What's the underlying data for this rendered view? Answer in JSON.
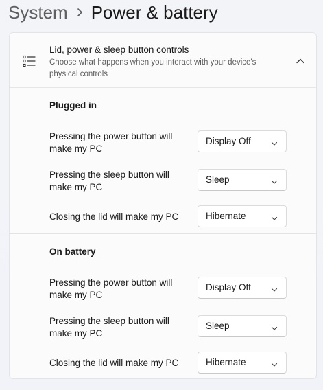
{
  "breadcrumb": {
    "parent": "System",
    "current": "Power & battery"
  },
  "card": {
    "title": "Lid, power & sleep button controls",
    "description": "Choose what happens when you interact with your device's physical controls",
    "icon": "list-settings-icon",
    "collapse_icon": "chevron-up-icon"
  },
  "plugged_in": {
    "title": "Plugged in",
    "rows": [
      {
        "label": "Pressing the power button will make my PC",
        "value": "Display Off"
      },
      {
        "label": "Pressing the sleep button will make my PC",
        "value": "Sleep"
      },
      {
        "label": "Closing the lid will make my PC",
        "value": "Hibernate"
      }
    ]
  },
  "on_battery": {
    "title": "On battery",
    "rows": [
      {
        "label": "Pressing the power button will make my PC",
        "value": "Display Off"
      },
      {
        "label": "Pressing the sleep button will make my PC",
        "value": "Sleep"
      },
      {
        "label": "Closing the lid will make my PC",
        "value": "Hibernate"
      }
    ]
  },
  "colors": {
    "background": "#f2f3f8",
    "card": "#fbfbfc",
    "text_primary": "#1b1b1b",
    "text_secondary": "#5d5d5d"
  }
}
